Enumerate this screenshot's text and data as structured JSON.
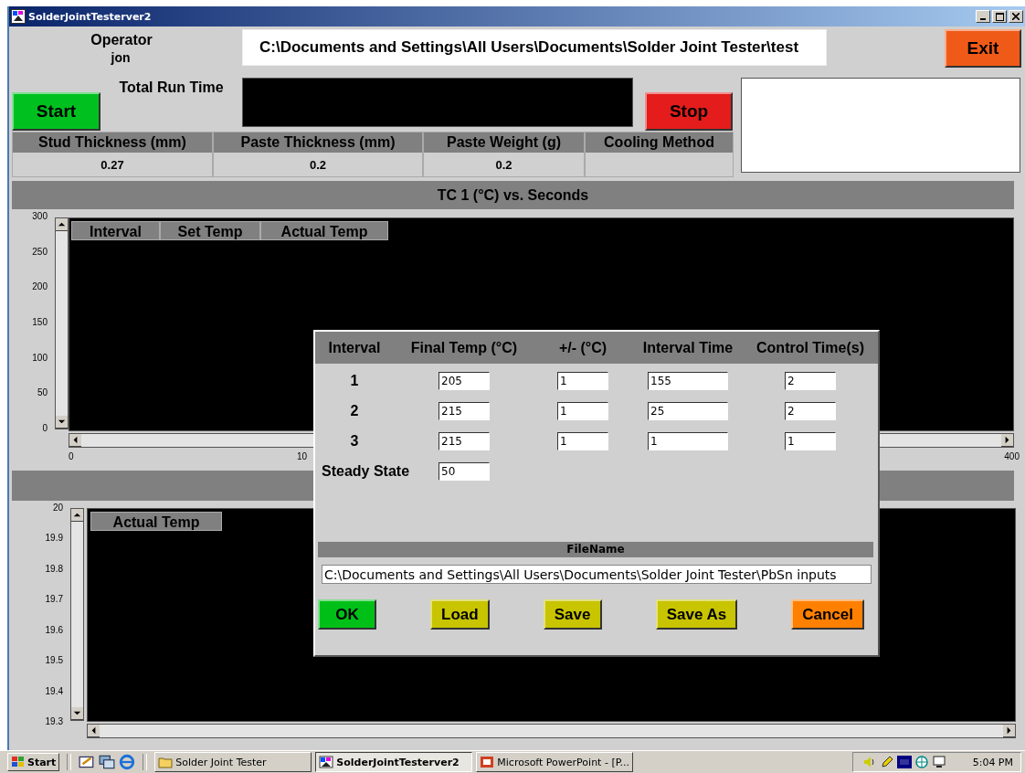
{
  "window": {
    "title": "SolderJointTesterver2"
  },
  "operator": {
    "label": "Operator",
    "name": "jon"
  },
  "file_path": "C:\\Documents and Settings\\All Users\\Documents\\Solder Joint Tester\\test",
  "exit_button": "Exit",
  "start_button": "Start",
  "stop_button": "Stop",
  "total_run_time": {
    "label": "Total Run Time"
  },
  "parameters": [
    {
      "label": "Stud Thickness (mm)",
      "value": "0.27"
    },
    {
      "label": "Paste Thickness (mm)",
      "value": "0.2"
    },
    {
      "label": "Paste Weight (g)",
      "value": "0.2"
    },
    {
      "label": "Cooling Method"
    }
  ],
  "charts": [
    {
      "title": "TC 1 (°C) vs. Seconds",
      "legend": [
        "Interval",
        "Set Temp",
        "Actual Temp"
      ],
      "y_ticks": [
        "300",
        "250",
        "200",
        "150",
        "100",
        "50",
        "0"
      ],
      "x_ticks": [
        "0",
        "10",
        "400"
      ]
    },
    {
      "legend": [
        "Actual Temp"
      ],
      "y_ticks": [
        "20",
        "19.9",
        "19.8",
        "19.7",
        "19.6",
        "19.5",
        "19.4",
        "19.3"
      ]
    }
  ],
  "dialog": {
    "columns": [
      "Interval",
      "Final Temp (°C)",
      "+/- (°C)",
      "Interval Time",
      "Control Time(s)"
    ],
    "rows": [
      {
        "label": "1",
        "values": [
          "205",
          "1",
          "155",
          "2"
        ]
      },
      {
        "label": "2",
        "values": [
          "215",
          "1",
          "25",
          "2"
        ]
      },
      {
        "label": "3",
        "values": [
          "215",
          "1",
          "1",
          "1"
        ]
      },
      {
        "label": "Steady State",
        "values": [
          "50"
        ]
      }
    ],
    "filename_label": "FileName",
    "filename": "C:\\Documents and Settings\\All Users\\Documents\\Solder Joint Tester\\PbSn inputs",
    "buttons": [
      {
        "label": "OK",
        "color": "#00c018"
      },
      {
        "label": "Load",
        "color": "#c8c400"
      },
      {
        "label": "Save",
        "color": "#c8c400"
      },
      {
        "label": "Save As",
        "color": "#c8c400"
      },
      {
        "label": "Cancel",
        "color": "#ff8000"
      }
    ]
  },
  "taskbar": {
    "start": "Start",
    "tasks": [
      {
        "label": "Solder Joint Tester",
        "kind": "folder",
        "selected": false
      },
      {
        "label": "SolderJointTesterver2",
        "kind": "app",
        "selected": true
      },
      {
        "label": "Microsoft PowerPoint - [P...",
        "kind": "slides",
        "selected": false
      }
    ],
    "clock": "5:04 PM"
  }
}
